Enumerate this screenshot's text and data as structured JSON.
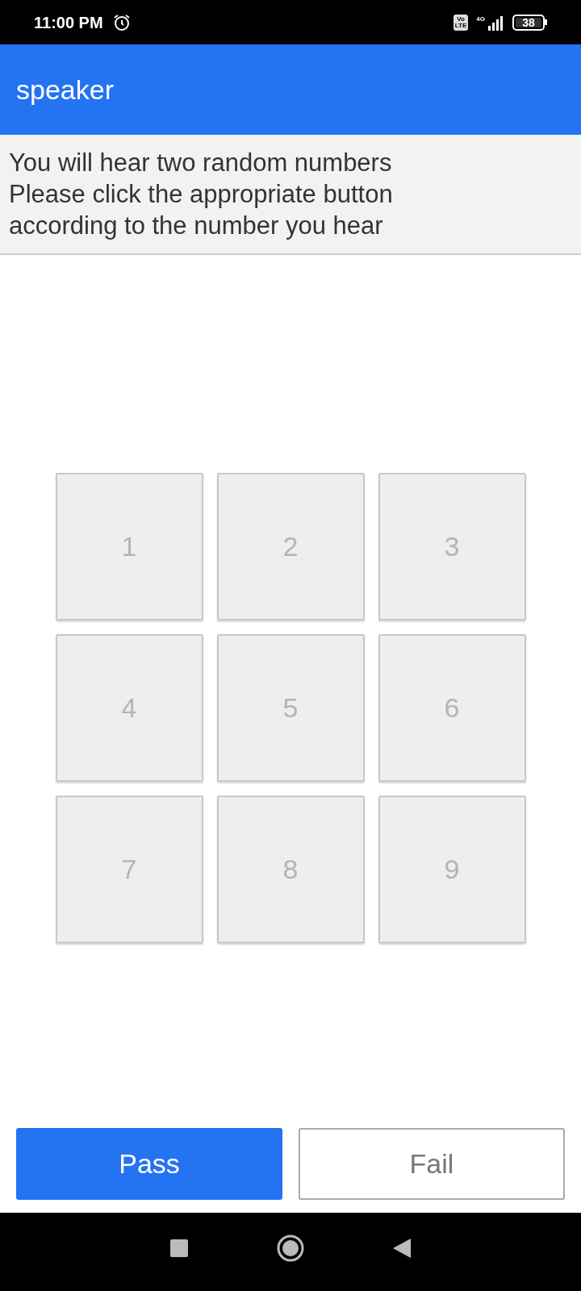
{
  "status_bar": {
    "time": "11:00 PM",
    "volte": "Vo\nLTE",
    "network": "4G",
    "battery": "38"
  },
  "app_bar": {
    "title": "speaker"
  },
  "instructions": [
    "You will hear two random numbers",
    "Please click the appropriate button",
    "according to the number you hear"
  ],
  "keypad": [
    {
      "label": "1",
      "disabled": true
    },
    {
      "label": "2",
      "disabled": true
    },
    {
      "label": "3",
      "disabled": true
    },
    {
      "label": "4",
      "disabled": true
    },
    {
      "label": "5",
      "disabled": true
    },
    {
      "label": "6",
      "disabled": true
    },
    {
      "label": "7",
      "disabled": true
    },
    {
      "label": "8",
      "disabled": true
    },
    {
      "label": "9",
      "disabled": true
    }
  ],
  "actions": [
    {
      "label": "Pass",
      "kind": "primary"
    },
    {
      "label": "Fail",
      "kind": "outline"
    }
  ]
}
